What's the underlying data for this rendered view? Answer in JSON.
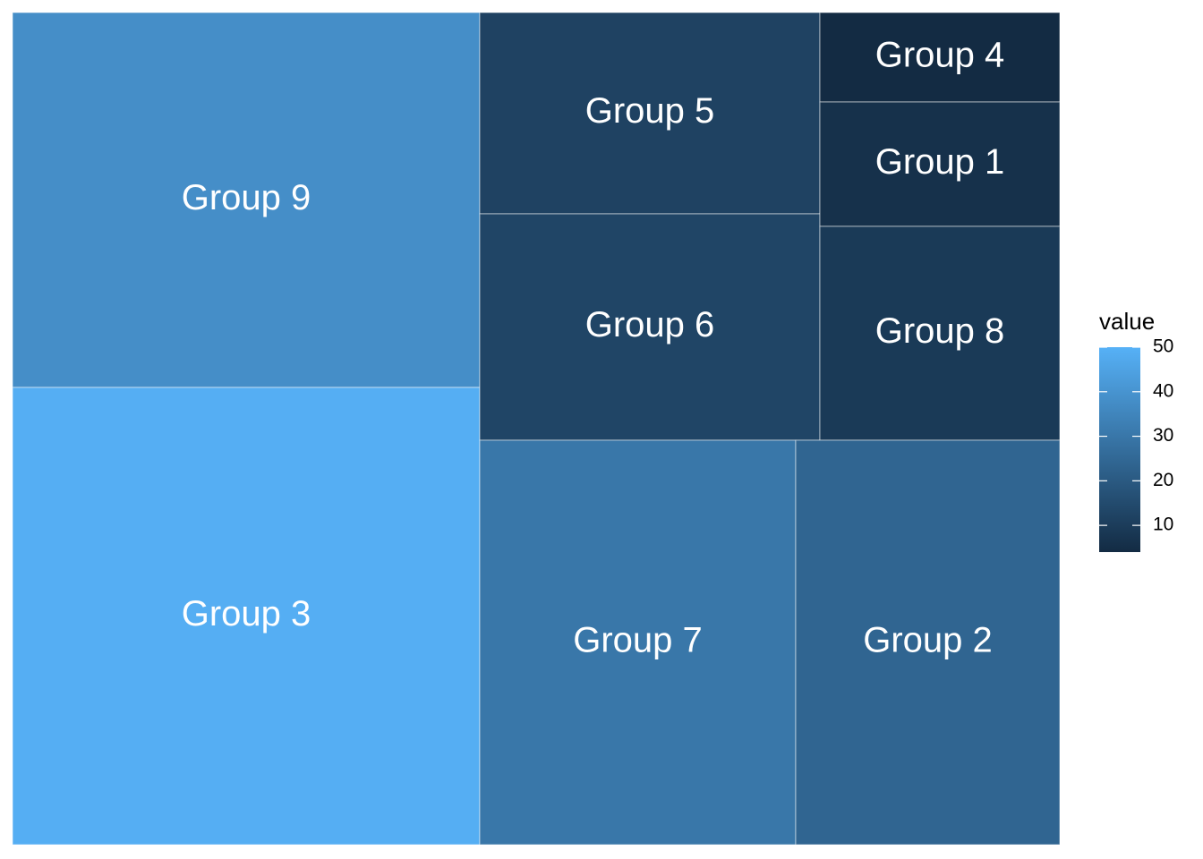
{
  "chart_data": {
    "type": "treemap",
    "tiles": [
      {
        "label": "Group 9",
        "value": 38
      },
      {
        "label": "Group 3",
        "value": 49
      },
      {
        "label": "Group 5",
        "value": 12
      },
      {
        "label": "Group 6",
        "value": 13
      },
      {
        "label": "Group 4",
        "value": 4
      },
      {
        "label": "Group 1",
        "value": 6
      },
      {
        "label": "Group 8",
        "value": 9
      },
      {
        "label": "Group 7",
        "value": 30
      },
      {
        "label": "Group 2",
        "value": 24
      }
    ],
    "legend": {
      "title": "value",
      "placement": "right",
      "ticks": [
        50,
        40,
        30,
        20,
        10
      ],
      "range": [
        4,
        50
      ]
    },
    "colors": {
      "low": "#132B43",
      "high": "#56B1F7"
    }
  }
}
